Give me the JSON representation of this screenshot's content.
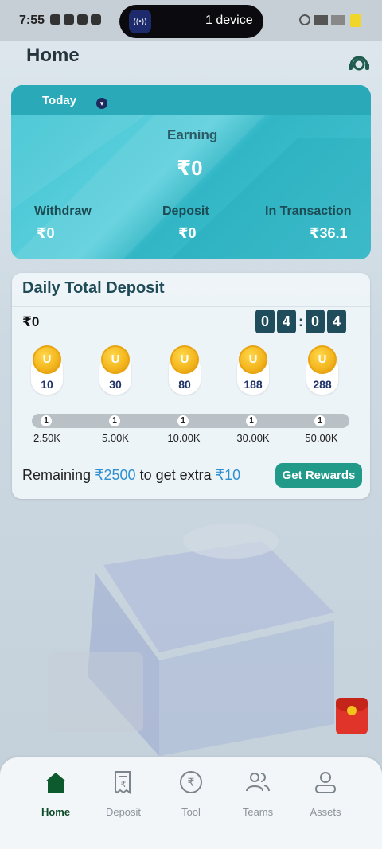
{
  "status_bar": {
    "time": "7:55",
    "pill_text": "1 device"
  },
  "header": {
    "title": "Home"
  },
  "earnings_card": {
    "period": "Today",
    "earning_label": "Earning",
    "earning_value": "₹0",
    "withdraw_label": "Withdraw",
    "withdraw_value": "₹0",
    "deposit_label": "Deposit",
    "deposit_value": "₹0",
    "in_transaction_label": "In Transaction",
    "in_transaction_value": "₹36.1"
  },
  "daily_deposit": {
    "title": "Daily Total Deposit",
    "amount": "₹0",
    "timer": {
      "h1": "0",
      "h2": "4",
      "m1": "0",
      "m2": "4"
    },
    "rewards": [
      "10",
      "30",
      "80",
      "188",
      "288"
    ],
    "milestones": [
      {
        "count": "1",
        "label": "2.50K"
      },
      {
        "count": "1",
        "label": "5.00K"
      },
      {
        "count": "1",
        "label": "10.00K"
      },
      {
        "count": "1",
        "label": "30.00K"
      },
      {
        "count": "1",
        "label": "50.00K"
      }
    ],
    "remaining_prefix": "Remaining",
    "remaining_amount": "₹2500",
    "remaining_middle": "to get extra",
    "remaining_extra": "₹10",
    "button_label": "Get Rewards"
  },
  "nav": {
    "items": [
      {
        "label": "Home",
        "icon": "home-icon"
      },
      {
        "label": "Deposit",
        "icon": "deposit-icon"
      },
      {
        "label": "Tool",
        "icon": "rupee-coin-icon"
      },
      {
        "label": "Teams",
        "icon": "teams-icon"
      },
      {
        "label": "Assets",
        "icon": "user-icon"
      }
    ]
  },
  "colors": {
    "accent": "#229a8a",
    "card": "#3fc3d2",
    "active_nav": "#0d4a2a",
    "highlight": "#2f8fcf"
  }
}
